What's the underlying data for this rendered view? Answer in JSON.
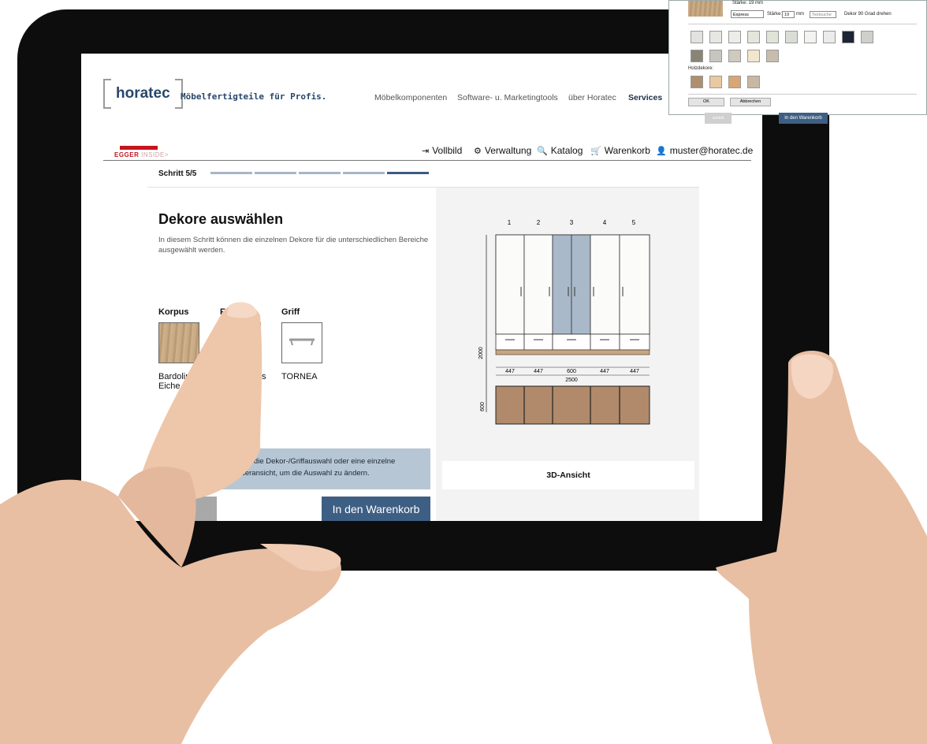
{
  "header": {
    "logo": "horatec",
    "tagline": "Möbelfertigteile für Profis.",
    "nav": [
      "Möbelkomponenten",
      "Software- u. Marketingtools",
      "über Horatec",
      "Services"
    ]
  },
  "egger": {
    "brand": "EGGER",
    "inside": "INSIDE>"
  },
  "toolbar": {
    "fullscreen": "Vollbild",
    "admin": "Verwaltung",
    "catalog": "Katalog",
    "cart": "Warenkorb",
    "user": "muster@horatec.de"
  },
  "step": {
    "label": "Schritt 5/5",
    "total": 5,
    "current": 5
  },
  "main": {
    "title": "Dekore auswählen",
    "intro": "In diesem Schritt können die einzelnen Dekore für die unterschiedlichen Bereiche ausgewählt werden.",
    "decor": [
      {
        "label": "Korpus",
        "name": "Bardolino Eiche"
      },
      {
        "label": "F",
        "name": "eiss"
      },
      {
        "label": "Griff",
        "name": "TORNEA"
      }
    ],
    "hint_line1": "cken Sie auf die Dekor-/Griffauswahl oder eine einzelne",
    "hint_line2": "n der Vorderansicht, um die Auswahl zu ändern.",
    "cart_button": "In den Warenkorb"
  },
  "drawing": {
    "doors": [
      "1",
      "2",
      "3",
      "4",
      "5"
    ],
    "height": "2000",
    "widths": [
      "447",
      "447",
      "600",
      "447",
      "447"
    ],
    "total": "2500",
    "depth": "600"
  },
  "view_button": "3D-Ansicht",
  "popup": {
    "staerke_top": "Stärke:",
    "staerke_val": "19 mm",
    "select": "Express",
    "staerke2": "Stärke:",
    "staerke2_val": "19",
    "mm": "mm",
    "search_placeholder": "Textsuche",
    "rotate": "Dekor 90 Grad drehen",
    "holz_label": "Holzdekore:",
    "ok": "OK",
    "cancel": "Abbrechen",
    "back_btn": "zurück",
    "cart_btn": "In den Warenkorb",
    "colors": {
      "uni": [
        "#e2e2e0",
        "#e6e6e3",
        "#ecece9",
        "#e4e6dc",
        "#e0e3d8",
        "#d9ddd6",
        "#f3f3f1",
        "#ebebeb",
        "#1d2433",
        "#cfd0cc"
      ],
      "uni2": [
        "#8a8476",
        "#c7c5c0",
        "#cfcabe",
        "#f2e6cf",
        "#c8bcab"
      ],
      "holz": [
        "#ae8f6f",
        "#e8c9a0",
        "#d9a673",
        "#c7b7a3"
      ]
    }
  },
  "colors": {
    "brand": "#27476b",
    "accent": "#3e5f84",
    "hint": "#b7c6d4",
    "door_blue": "#a9b9ca",
    "egger_red": "#c4161c"
  }
}
